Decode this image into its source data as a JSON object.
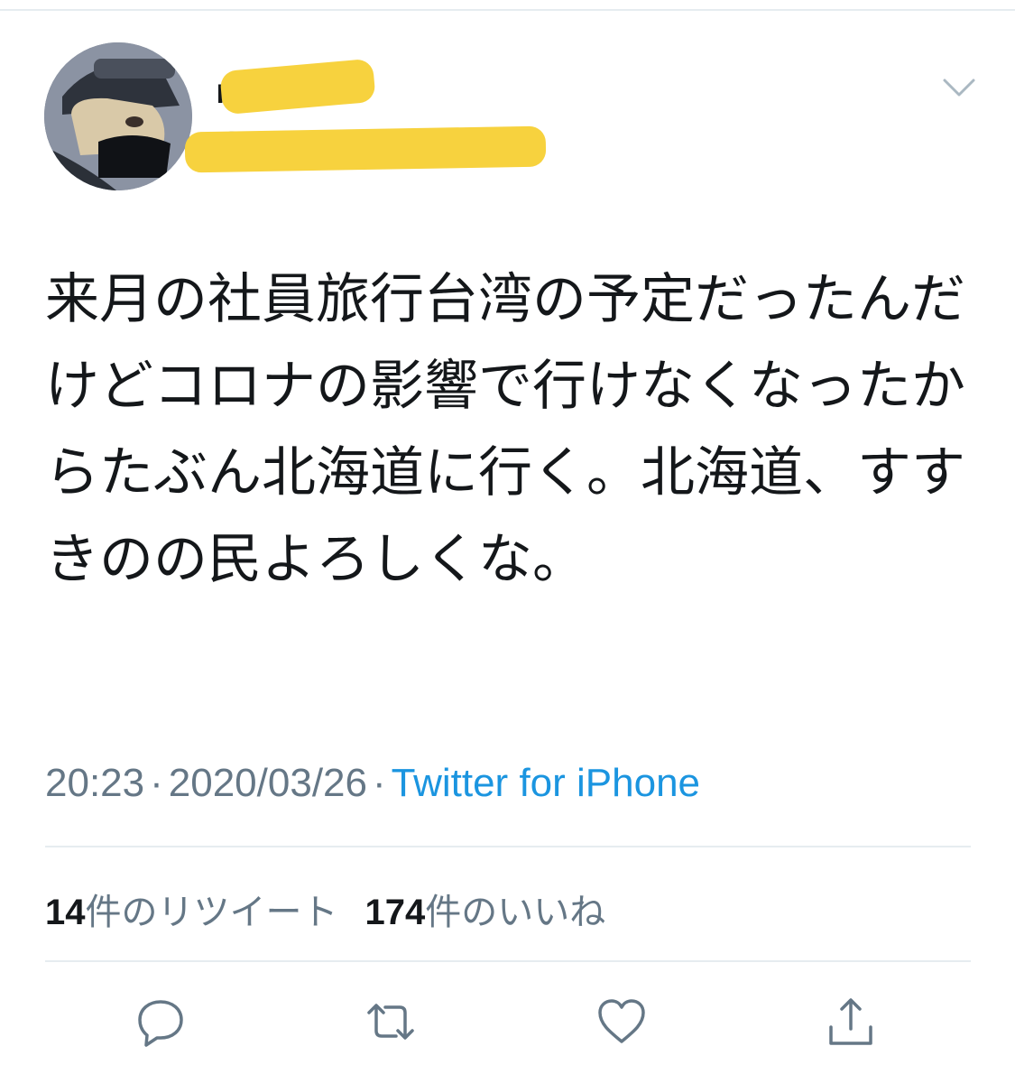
{
  "tweet": {
    "author": {
      "display_name": "P",
      "handle": "@"
    },
    "text": "来月の社員旅行台湾の予定だったんだけどコロナの影響で行けなくなったからたぶん北海道に行く。北海道、すすきのの民よろしくな。",
    "time": "20:23",
    "separator": "·",
    "date": "2020/03/26",
    "source": "Twitter for iPhone",
    "stats": {
      "retweet_count": "14",
      "retweet_label": "件のリツイート",
      "like_count": "174",
      "like_label": "件のいいね"
    }
  },
  "icons": {
    "more": "chevron-down-icon",
    "reply": "reply-icon",
    "retweet": "retweet-icon",
    "like": "heart-icon",
    "share": "share-icon"
  },
  "colors": {
    "text": "#14171a",
    "muted": "#657786",
    "link": "#1b95e0",
    "divider": "#e6ecf0",
    "redaction": "#f7d23e"
  }
}
